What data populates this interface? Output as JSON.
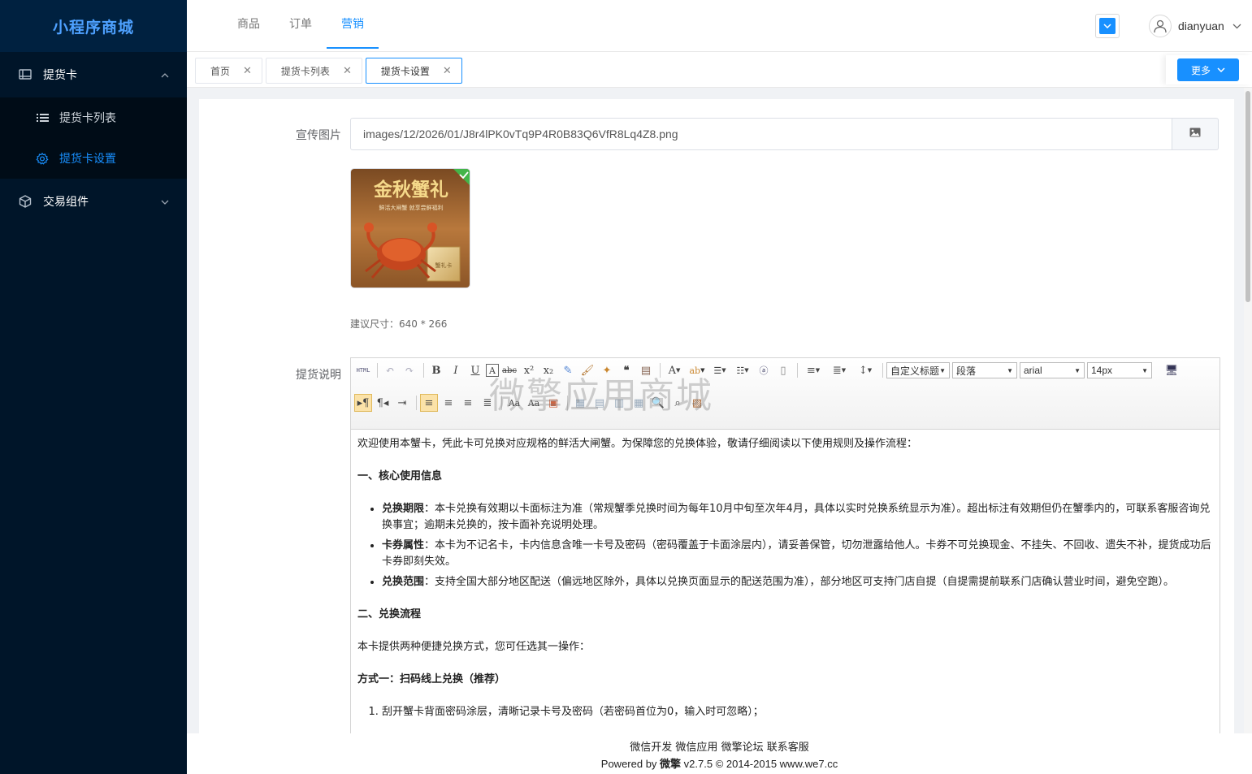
{
  "app": {
    "title": "小程序商城"
  },
  "sidebar": {
    "groups": [
      {
        "label": "提货卡",
        "items": [
          {
            "label": "提货卡列表"
          },
          {
            "label": "提货卡设置"
          }
        ]
      },
      {
        "label": "交易组件"
      }
    ]
  },
  "header": {
    "nav": [
      {
        "label": "商品"
      },
      {
        "label": "订单"
      },
      {
        "label": "营销"
      }
    ],
    "username": "dianyuan"
  },
  "tabs": [
    {
      "label": "首页"
    },
    {
      "label": "提货卡列表"
    },
    {
      "label": "提货卡设置"
    }
  ],
  "more_label": "更多",
  "form": {
    "image_label": "宣传图片",
    "image_path": "images/12/2026/01/J8r4lPK0vTq9P4R0B83Q6VfR8Lq4Z8.png",
    "size_hint": "建议尺寸：640 * 266",
    "desc_label": "提货说明"
  },
  "poster": {
    "title": "金秋蟹礼",
    "subtitle": "鲜活大闸蟹 就享尝鲜福利",
    "box_text": "蟹礼卡"
  },
  "editor": {
    "toolbar": {
      "heading_select": "自定义标题",
      "paragraph_select": "段落",
      "font_select": "arial",
      "size_select": "14px"
    },
    "watermark": "微擎应用商城",
    "content": {
      "intro": "欢迎使用本蟹卡，凭此卡可兑换对应规格的鲜活大闸蟹。为保障您的兑换体验，敬请仔细阅读以下使用规则及操作流程：",
      "section1": "一、核心使用信息",
      "bullets": [
        {
          "term": "兑换期限",
          "text": "：本卡兑换有效期以卡面标注为准（常规蟹季兑换时间为每年10月中旬至次年4月，具体以实时兑换系统显示为准）。超出标注有效期但仍在蟹季内的，可联系客服咨询兑换事宜；逾期未兑换的，按卡面补充说明处理。"
        },
        {
          "term": "卡券属性",
          "text": "：本卡为不记名卡，卡内信息含唯一卡号及密码（密码覆盖于卡面涂层内），请妥善保管，切勿泄露给他人。卡券不可兑换现金、不挂失、不回收、遗失不补，提货成功后卡券即刻失效。"
        },
        {
          "term": "兑换范围",
          "text": "：支持全国大部分地区配送（偏远地区除外，具体以兑换页面显示的配送范围为准），部分地区可支持门店自提（自提需提前联系门店确认营业时间，避免空跑）。"
        }
      ],
      "section2": "二、兑换流程",
      "flow_intro": "本卡提供两种便捷兑换方式，您可任选其一操作：",
      "method1": "方式一：扫码线上兑换（推荐）",
      "steps": [
        "刮开蟹卡背面密码涂层，清晰记录卡号及密码（若密码首位为0，输入时可忽略）；"
      ]
    }
  },
  "footer": {
    "links": [
      "微信开发",
      "微信应用",
      "微擎论坛",
      "联系客服"
    ],
    "powered_prefix": "Powered by ",
    "brand": "微擎",
    "powered_suffix": " v2.7.5 © 2014-2015 www.we7.cc"
  },
  "colors": {
    "sidebar": "#001529",
    "accent": "#1890ff"
  }
}
